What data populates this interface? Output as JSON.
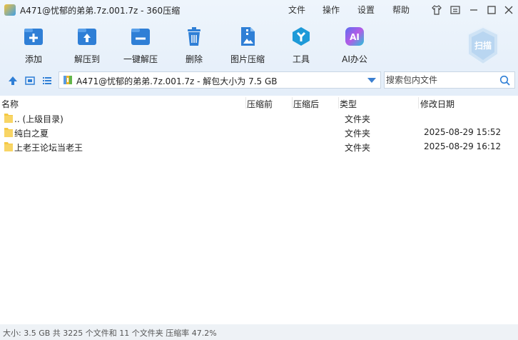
{
  "window": {
    "title": "A471@忧郁的弟弟.7z.001.7z - 360压缩",
    "menu": [
      "文件",
      "操作",
      "设置",
      "帮助"
    ]
  },
  "toolbar": {
    "items": [
      {
        "label": "添加",
        "icon": "add-icon"
      },
      {
        "label": "解压到",
        "icon": "extract-to-icon"
      },
      {
        "label": "一键解压",
        "icon": "one-click-extract-icon"
      },
      {
        "label": "删除",
        "icon": "delete-icon"
      },
      {
        "label": "图片压缩",
        "icon": "image-compress-icon"
      },
      {
        "label": "工具",
        "icon": "tools-icon"
      },
      {
        "label": "AI办公",
        "icon": "ai-office-icon"
      }
    ],
    "scan_label": "扫描",
    "ai_badge": "AI"
  },
  "address": {
    "path": "A471@忧郁的弟弟.7z.001.7z - 解包大小为 7.5 GB"
  },
  "search": {
    "placeholder": "搜索包内文件"
  },
  "columns": {
    "name": "名称",
    "before": "压缩前",
    "after": "压缩后",
    "type": "类型",
    "modified": "修改日期"
  },
  "files": [
    {
      "name": ".. (上级目录)",
      "type": "文件夹",
      "modified": ""
    },
    {
      "name": "纯白之夏",
      "type": "文件夹",
      "modified": "2025-08-29 15:52"
    },
    {
      "name": "上老王论坛当老王",
      "type": "文件夹",
      "modified": "2025-08-29 16:12"
    }
  ],
  "status": {
    "text": "大小: 3.5 GB 共 3225 个文件和 11 个文件夹 压缩率 47.2%"
  },
  "colors": {
    "accent": "#2f7fd6",
    "toolbar_bg": "#e9f2fb",
    "folder": "#f5c842"
  }
}
